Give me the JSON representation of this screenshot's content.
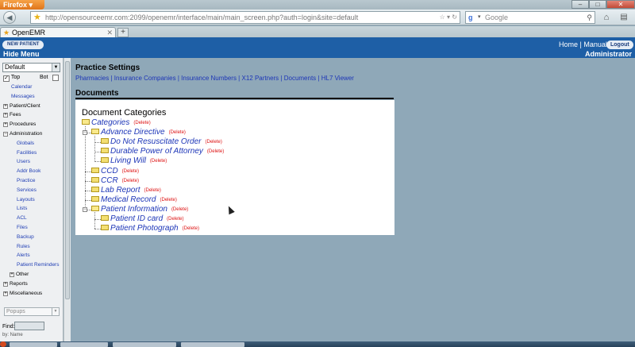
{
  "browser": {
    "menu_button": "Firefox",
    "url": "http://opensourceemr.com:2099/openemr/interface/main/main_screen.php?auth=login&site=default",
    "search_engine": "Google",
    "search_placeholder": "Google",
    "tab_label": "OpenEMR",
    "new_tab": "+"
  },
  "header": {
    "new_patient": "NEW PATIENT",
    "hide_menu": "Hide Menu",
    "home": "Home",
    "sep": "|",
    "manual": "Manual",
    "logout": "Logout",
    "user": "Administrator"
  },
  "leftnav": {
    "frame_select": "Default",
    "top_label": "Top",
    "bot_label": "Bot",
    "items": [
      {
        "label": "Calendar",
        "kind": "link"
      },
      {
        "label": "Messages",
        "kind": "link"
      },
      {
        "label": "Patient/Client",
        "kind": "group",
        "sign": "+"
      },
      {
        "label": "Fees",
        "kind": "group",
        "sign": "+"
      },
      {
        "label": "Procedures",
        "kind": "group",
        "sign": "+"
      },
      {
        "label": "Administration",
        "kind": "group",
        "sign": "−"
      },
      {
        "label": "Globals",
        "kind": "sub"
      },
      {
        "label": "Facilities",
        "kind": "sub"
      },
      {
        "label": "Users",
        "kind": "sub"
      },
      {
        "label": "Addr Book",
        "kind": "sub"
      },
      {
        "label": "Practice",
        "kind": "sub"
      },
      {
        "label": "Services",
        "kind": "sub"
      },
      {
        "label": "Layouts",
        "kind": "sub"
      },
      {
        "label": "Lists",
        "kind": "sub"
      },
      {
        "label": "ACL",
        "kind": "sub"
      },
      {
        "label": "Files",
        "kind": "sub"
      },
      {
        "label": "Backup",
        "kind": "sub"
      },
      {
        "label": "Rules",
        "kind": "sub"
      },
      {
        "label": "Alerts",
        "kind": "sub"
      },
      {
        "label": "Patient Reminders",
        "kind": "sub"
      },
      {
        "label": "Other",
        "kind": "subgroup",
        "sign": "+"
      },
      {
        "label": "Reports",
        "kind": "group",
        "sign": "+"
      },
      {
        "label": "Miscellaneous",
        "kind": "group",
        "sign": "+"
      }
    ],
    "popups": "Popups",
    "find_label": "Find:",
    "cut_text": "by: Name"
  },
  "main": {
    "heading": "Practice Settings",
    "links": [
      "Pharmacies",
      "Insurance Companies",
      "Insurance Numbers",
      "X12 Partners",
      "Documents",
      "HL7 Viewer"
    ],
    "link_sep": " | ",
    "section_title": "Documents",
    "categories_heading": "Document Categories",
    "delete_label": "(Delete)",
    "tree": [
      {
        "label": "Categories"
      },
      {
        "label": "Advance Directive"
      },
      {
        "label": "Do Not Resuscitate Order"
      },
      {
        "label": "Durable Power of Attorney"
      },
      {
        "label": "Living Will"
      },
      {
        "label": "CCD"
      },
      {
        "label": "CCR"
      },
      {
        "label": "Lab Report"
      },
      {
        "label": "Medical Record"
      },
      {
        "label": "Patient Information"
      },
      {
        "label": "Patient ID card"
      },
      {
        "label": "Patient Photograph"
      }
    ]
  },
  "icons": {
    "back": "back-arrow-icon",
    "forward": "forward-arrow-icon",
    "bookmark_star": "star-icon",
    "home": "home-icon",
    "folder": "folder-icon"
  }
}
